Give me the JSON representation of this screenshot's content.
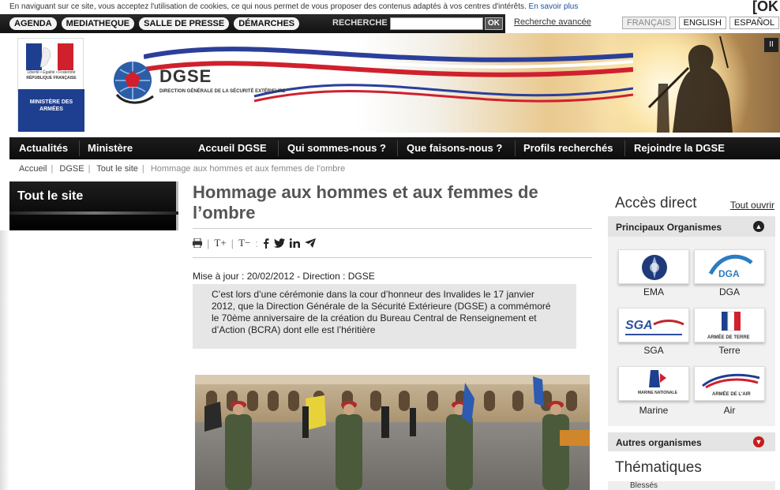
{
  "cookie": {
    "text": "En naviguant sur ce site, vous acceptez l'utilisation de cookies, ce qui nous permet de vous proposer des contenus adaptés à vos centres d'intérêts.",
    "link": "En savoir plus",
    "ok": "[OK"
  },
  "topnav": {
    "items": [
      "AGENDA",
      "MEDIATHEQUE",
      "SALLE DE PRESSE",
      "DÉMARCHES"
    ],
    "search_label": "RECHERCHE",
    "search_placeholder": "",
    "ok": "OK",
    "advanced": "Recherche avancée"
  },
  "languages": [
    "FRANÇAIS",
    "ENGLISH",
    "ESPAÑOL"
  ],
  "banner": {
    "ministry_motto": "Liberté • Égalité • Fraternité",
    "ministry_republic": "RÉPUBLIQUE FRANÇAISE",
    "ministry_name": "MINISTÈRE DES ARMÉES",
    "logo": "DGSE",
    "logo_sub": "DIRECTION GÉNÉRALE DE LA SÉCURITÉ EXTÉRIEURE",
    "pause": "II"
  },
  "mainnav": [
    "Actualités",
    "Ministère",
    "Accueil DGSE",
    "Qui sommes-nous ?",
    "Que faisons-nous ?",
    "Profils recherchés",
    "Rejoindre la DGSE"
  ],
  "breadcrumb": [
    "Accueil",
    "DGSE",
    "Tout le site",
    "Hommage aux hommes et aux femmes de l’ombre"
  ],
  "left_panel": {
    "title": "Tout le site"
  },
  "article": {
    "title": "Hommage aux hommes et aux femmes de l’ombre",
    "tools": [
      "T+",
      "T−"
    ],
    "meta": "Mise à jour  : 20/02/2012 - Direction : DGSE",
    "chapo": "C’est lors d’une cérémonie dans la cour d’honneur des Invalides le 17 janvier 2012, que la Direction Générale de la Sécurité Extérieure (DGSE) a commémoré le 70ème  anniversaire de la création du Bureau Central de Renseignement et d’Action (BCRA) dont elle est l’héritière"
  },
  "sidebar": {
    "acces_title": "Accès direct",
    "open_all": "Tout ouvrir",
    "box_title": "Principaux Organismes",
    "organisms": [
      "EMA",
      "DGA",
      "SGA",
      "Terre",
      "Marine",
      "Air"
    ],
    "organism_logos": [
      "",
      "DGA",
      "SGA",
      "ARMÉE DE TERRE",
      "MARINE NATIONALE",
      "ARMÉE DE L'AIR"
    ],
    "other": "Autres organismes",
    "thematiques": "Thématiques",
    "blesses": "Blessés"
  }
}
